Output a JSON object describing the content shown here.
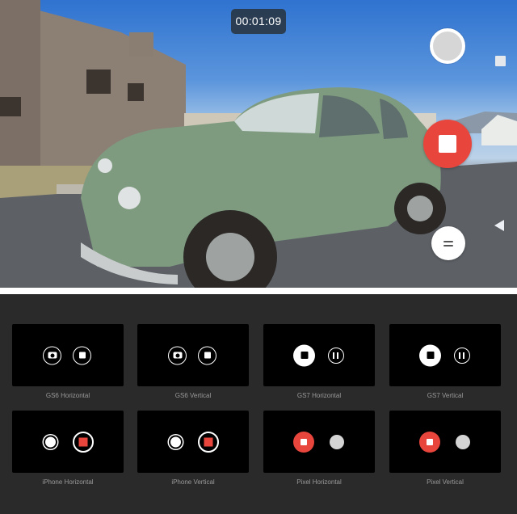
{
  "camera": {
    "timer": "00:01:09",
    "colors": {
      "record": "#e8463c",
      "shutter": "#d6d6d6"
    }
  },
  "gallery": {
    "items": [
      {
        "caption": "GS6 Horizontal",
        "variant": "gs6"
      },
      {
        "caption": "GS6 Vertical",
        "variant": "gs6"
      },
      {
        "caption": "GS7 Horizontal",
        "variant": "gs7"
      },
      {
        "caption": "GS7 Vertical",
        "variant": "gs7"
      },
      {
        "caption": "iPhone Horizontal",
        "variant": "iphone"
      },
      {
        "caption": "iPhone Vertical",
        "variant": "iphone"
      },
      {
        "caption": "Pixel Horizontal",
        "variant": "pixel"
      },
      {
        "caption": "Pixel Vertical",
        "variant": "pixel"
      }
    ]
  }
}
